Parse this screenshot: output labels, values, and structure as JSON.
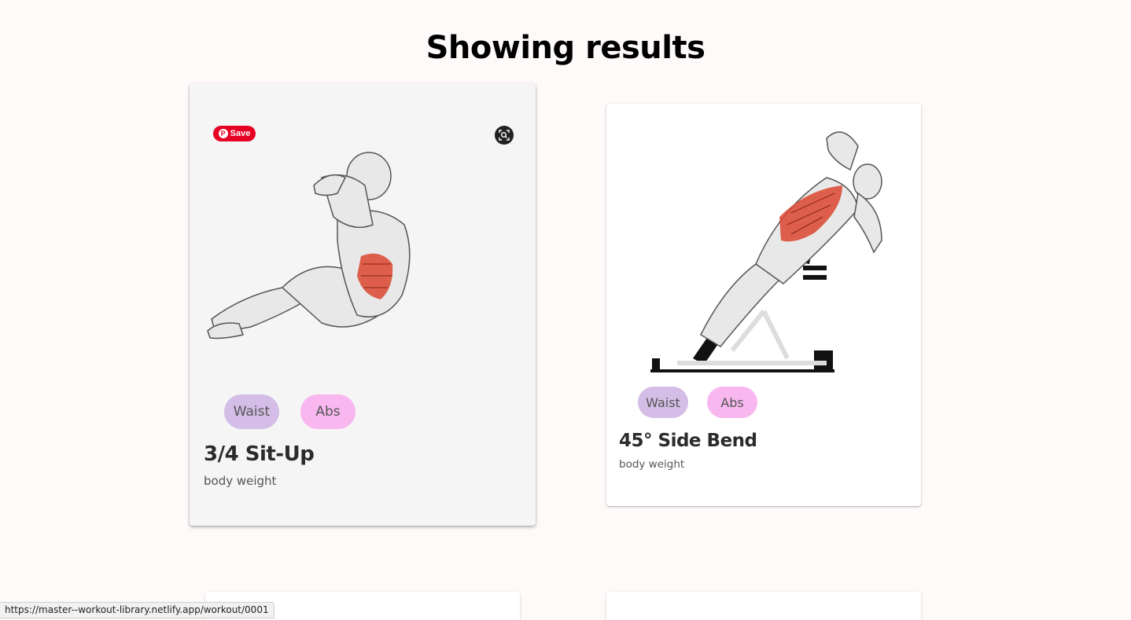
{
  "page": {
    "heading": "Showing results"
  },
  "cards": [
    {
      "title": "3/4 Sit-Up",
      "equipment": "body weight",
      "tags": [
        "Waist",
        "Abs"
      ],
      "pin_save_label": "Save"
    },
    {
      "title": "45° Side Bend",
      "equipment": "body weight",
      "tags": [
        "Waist",
        "Abs"
      ]
    }
  ],
  "colors": {
    "chip_waist": "#d4bde6",
    "chip_abs": "#f8b7ef",
    "pinterest_red": "#e60023",
    "highlight_muscle": "#d9452f",
    "page_bg": "#fffafa"
  },
  "icons": {
    "pin": "pinterest-icon",
    "lens": "visual-search-icon"
  },
  "status_bar": {
    "url": "https://master--workout-library.netlify.app/workout/0001"
  }
}
